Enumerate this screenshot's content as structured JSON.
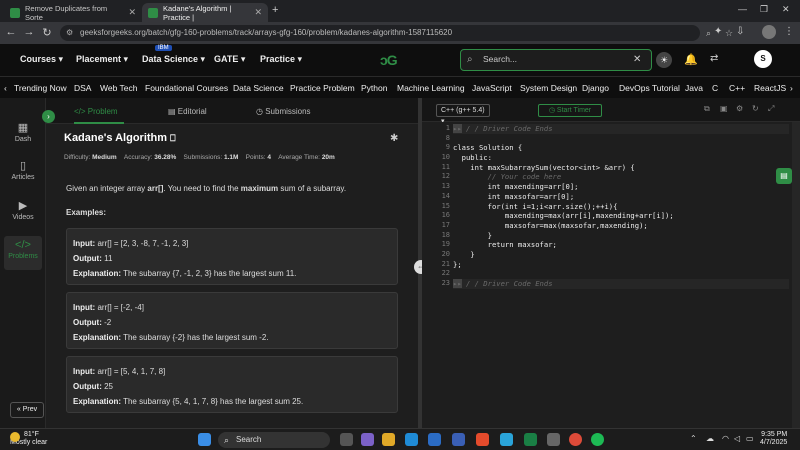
{
  "browser": {
    "tabs": [
      {
        "label": "Remove Duplicates from Sorte",
        "active": false
      },
      {
        "label": "Kadane's Algorithm | Practice |",
        "active": true
      }
    ],
    "new_tab": "+",
    "url": "geeksforgeeks.org/batch/gfg-160-problems/track/arrays-gfg-160/problem/kadanes-algorithm-1587115620"
  },
  "header": {
    "nav": [
      "Courses",
      "Placement",
      "Data Science",
      "GATE",
      "Practice"
    ],
    "ibm_badge": "IBM",
    "search_placeholder": "Search...",
    "avatar_letter": "S"
  },
  "category_bar": [
    "Trending Now",
    "DSA",
    "Web Tech",
    "Foundational Courses",
    "Data Science",
    "Practice Problem",
    "Python",
    "Machine Learning",
    "JavaScript",
    "System Design",
    "Django",
    "DevOps Tutorial",
    "Java",
    "C",
    "C++",
    "ReactJS"
  ],
  "sidebar": {
    "items": [
      {
        "label": "Dash",
        "icon": "dashboard-icon"
      },
      {
        "label": "Articles",
        "icon": "book-icon"
      },
      {
        "label": "Videos",
        "icon": "video-icon"
      },
      {
        "label": "Problems",
        "icon": "code-icon"
      }
    ],
    "prev_label": "Prev"
  },
  "problem_tabs": [
    "Problem",
    "Editorial",
    "Submissions"
  ],
  "problem": {
    "title": "Kadane's Algorithm",
    "difficulty_label": "Difficulty:",
    "difficulty": "Medium",
    "accuracy_label": "Accuracy:",
    "accuracy": "36.28%",
    "submissions_label": "Submissions:",
    "submissions": "1.1M",
    "points_label": "Points:",
    "points": "4",
    "avg_time_label": "Average Time:",
    "avg_time": "20m",
    "statement_pre": "Given an integer array ",
    "statement_arr": "arr[]",
    "statement_mid": ". You need to find the ",
    "statement_bold": "maximum",
    "statement_post": " sum of a subarray.",
    "examples_heading": "Examples:",
    "examples": [
      {
        "input": "arr[] = [2, 3, -8, 7, -1, 2, 3]",
        "output": "11",
        "explanation": "The subarray {7, -1, 2, 3} has the largest sum 11."
      },
      {
        "input": "arr[] = [-2, -4]",
        "output": "-2",
        "explanation": "The subarray {-2} has the largest sum -2."
      },
      {
        "input": "arr[] = [5, 4, 1, 7, 8]",
        "output": "25",
        "explanation": "The subarray {5, 4, 1, 7, 8} has the largest sum 25."
      }
    ],
    "input_label": "Input:",
    "output_label": "Output:",
    "explanation_label": "Explanation:"
  },
  "editor": {
    "language": "C++ (g++ 5.4)",
    "timer_label": "Start Timer",
    "line_numbers": [
      "1",
      "8",
      "9",
      "10",
      "11",
      "12",
      "13",
      "14",
      "15",
      "16",
      "17",
      "18",
      "19",
      "20",
      "21",
      "22",
      "23"
    ],
    "code_lines": [
      "/ / Driver Code Ends",
      "",
      "class Solution {",
      "  public:",
      "    int maxSubarraySum(vector<int> &arr) {",
      "        // Your code here",
      "        int maxending=arr[0];",
      "        int maxsofar=arr[0];",
      "        for(int i=1;i<arr.size();++i){",
      "            maxending=max(arr[i],maxending+arr[i]);",
      "            maxsofar=max(maxsofar,maxending);",
      "        }",
      "        return maxsofar;",
      "    }",
      "};",
      "",
      "/ / Driver Code Ends"
    ]
  },
  "taskbar": {
    "temperature": "81°F",
    "weather": "Mostly clear",
    "search_label": "Search",
    "time": "9:35 PM",
    "date": "4/7/2025"
  },
  "colors": {
    "accent": "#2f8d46",
    "editor_bg": "#1e1e1e",
    "chrome_bg": "#202124"
  }
}
